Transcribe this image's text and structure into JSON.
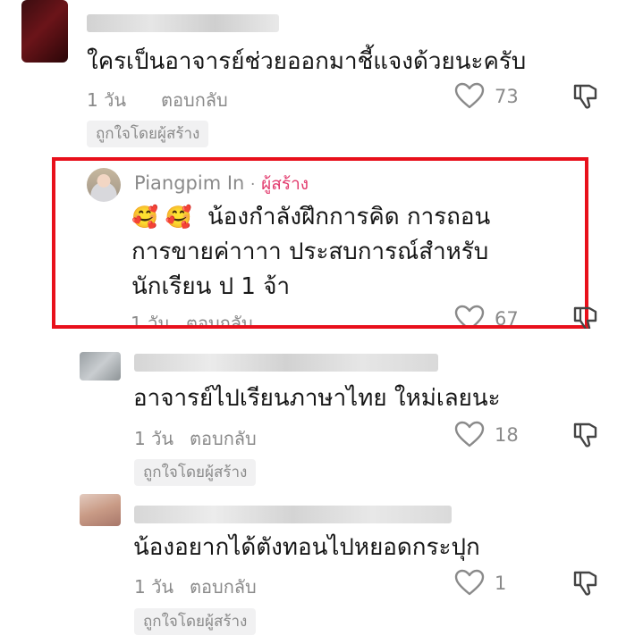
{
  "comments": [
    {
      "text": "ใครเป็นอาจารย์ช่วยออกมาชี้แจงด้วยนะครับ",
      "time": "1 วัน",
      "reply": "ตอบกลับ",
      "likes": "73",
      "liked_by_creator": "ถูกใจโดยผู้สร้าง"
    },
    {
      "author": "Piangpim In",
      "separator": "·",
      "creator_label": "ผู้สร้าง",
      "emoji": "🥰 🥰",
      "line1": "น้องกำลังฝึกการคิด การถอน",
      "line2": "การขายค่าาาา ประสบการณ์สำหรับ",
      "line3": "นักเรียน ป 1 จ้า",
      "time": "1 วัน",
      "reply": "ตอบกลับ",
      "likes": "67"
    },
    {
      "text": "อาจารย์ไปเรียนภาษาไทย ใหม่เลยนะ",
      "time": "1 วัน",
      "reply": "ตอบกลับ",
      "likes": "18",
      "liked_by_creator": "ถูกใจโดยผู้สร้าง"
    },
    {
      "text": "น้องอยากได้ตังทอนไปหยอดกระปุก",
      "time": "1 วัน",
      "reply": "ตอบกลับ",
      "likes": "1",
      "liked_by_creator": "ถูกใจโดยผู้สร้าง"
    }
  ],
  "colors": {
    "highlight_border": "#e8101b",
    "creator_tag": "#e23a6d",
    "meta_text": "#8a8a8a"
  },
  "icons": [
    "heart-icon",
    "dislike-icon"
  ]
}
